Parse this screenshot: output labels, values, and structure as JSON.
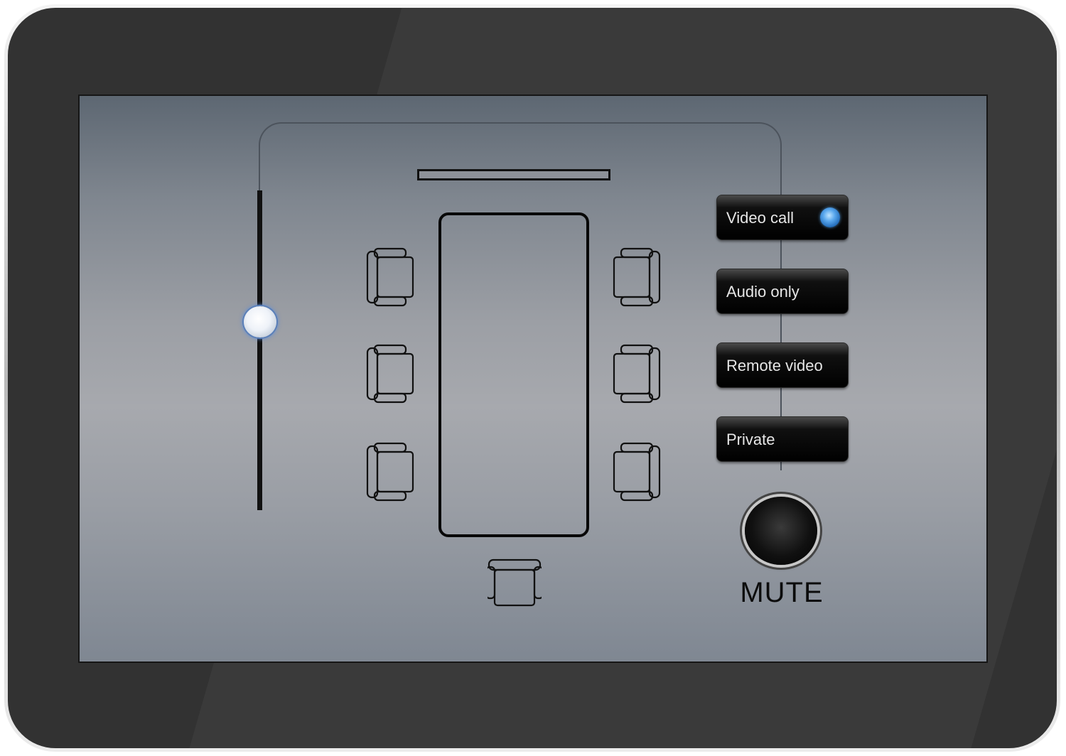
{
  "device": {
    "type": "wall-mounted touch panel"
  },
  "room_controls": {
    "volume_level_percent": 59,
    "modes": [
      {
        "label": "Video call",
        "active": true
      },
      {
        "label": "Audio only",
        "active": false
      },
      {
        "label": "Remote video",
        "active": false
      },
      {
        "label": "Private",
        "active": false
      }
    ],
    "mute": {
      "label": "MUTE"
    },
    "seating": {
      "left_chairs": 3,
      "right_chairs": 3,
      "bottom_chairs": 1
    }
  },
  "colors": {
    "accent_led": "#5aa8ee",
    "button_bg": "#000000",
    "screen_bg": "#a7a9ae",
    "bezel": "#323232"
  },
  "icons": {
    "chair": "chair-icon",
    "volume_thumb": "slider-thumb-icon",
    "active_indicator": "led-indicator-icon",
    "display": "display-screen-icon",
    "table": "conference-table-icon"
  }
}
